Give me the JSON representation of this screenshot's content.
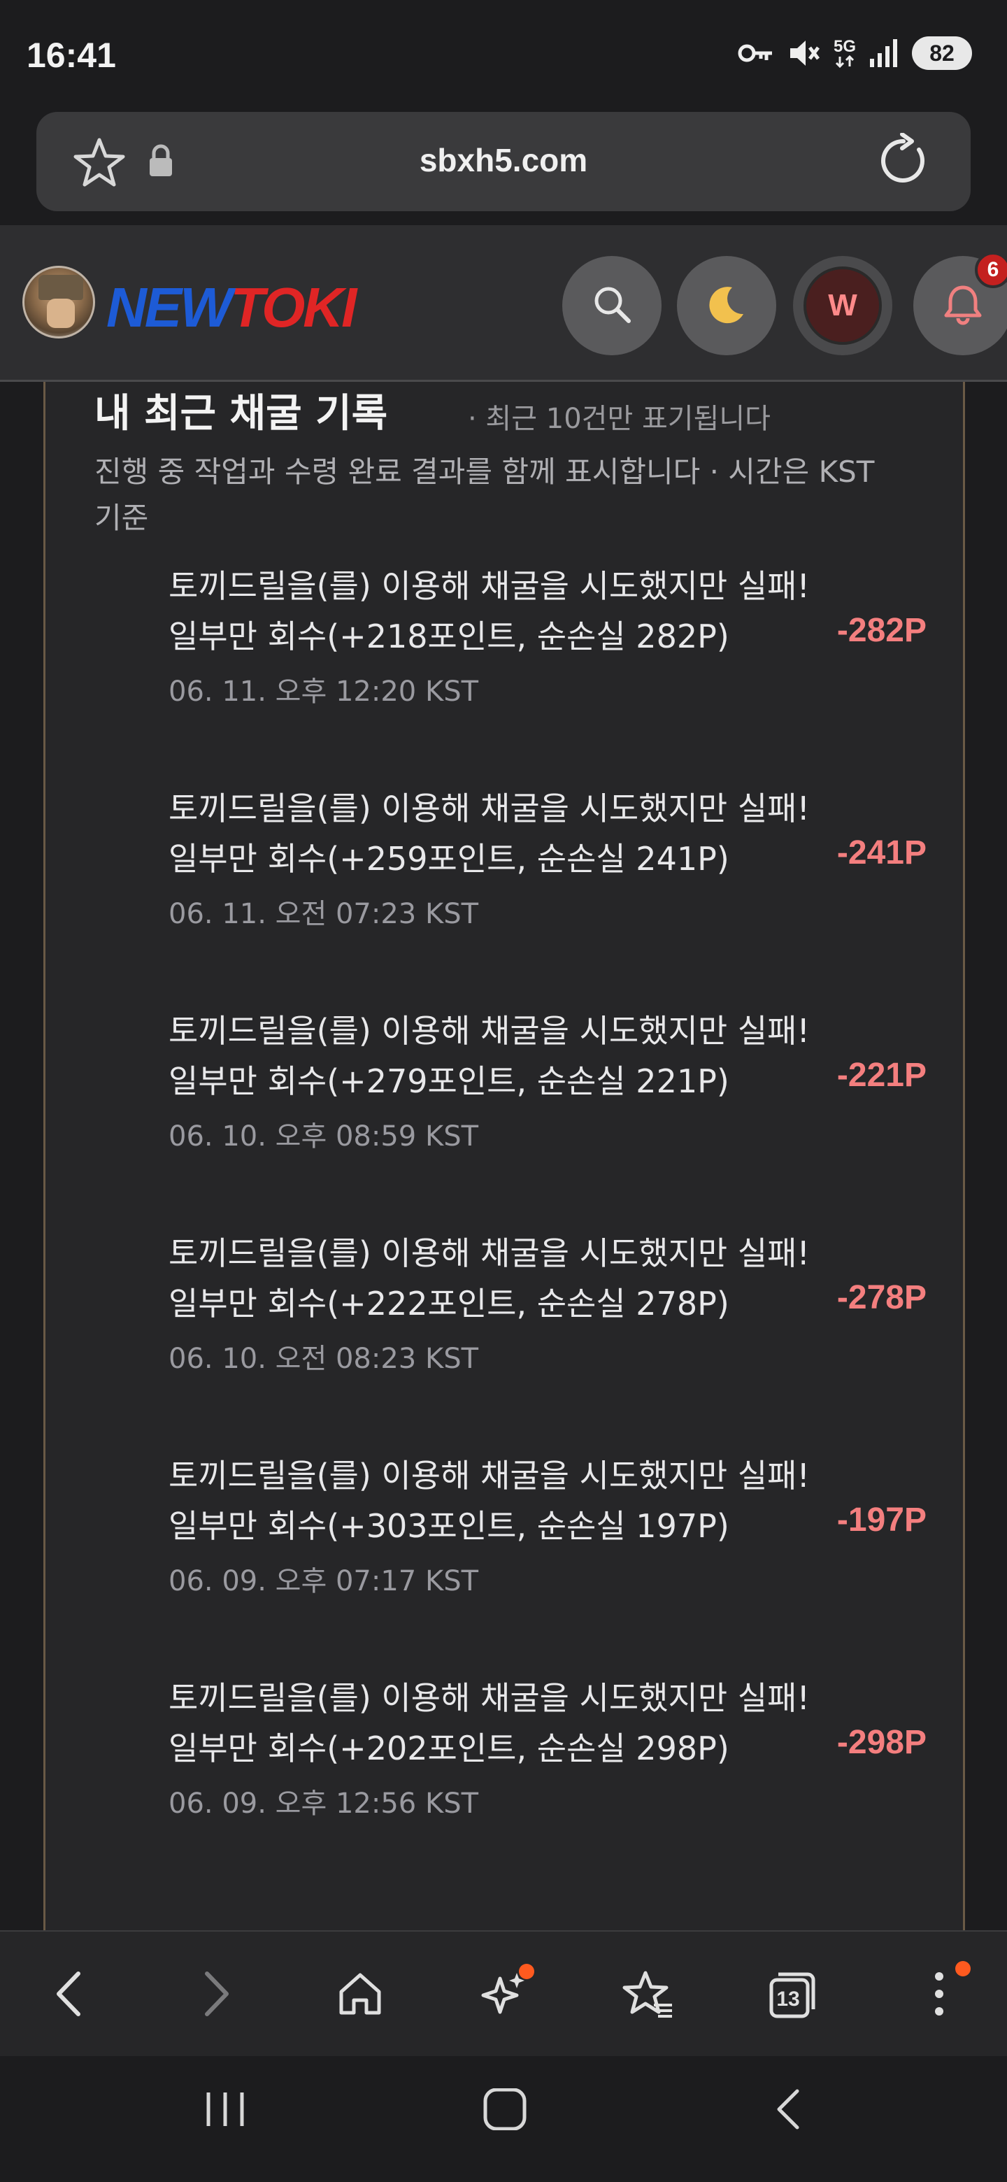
{
  "status_bar": {
    "time": "16:41",
    "network": "5G",
    "battery": "82",
    "icons": [
      "key-icon",
      "mute-icon",
      "5g-icon",
      "signal-icon",
      "battery-icon"
    ]
  },
  "url_bar": {
    "url": "sbxh5.com",
    "icons": [
      "star-icon",
      "lock-icon",
      "reload-icon"
    ]
  },
  "header": {
    "logo_part1": "NEW",
    "logo_part2": "TOKI",
    "user_initial": "W",
    "notification_count": "6",
    "logo_colors": {
      "new": "#1d5bd6",
      "toki": "#e02525"
    }
  },
  "section": {
    "title": "내 최근 채굴 기록",
    "note": "· 최근 10건만 표기됩니다",
    "description": "진행 중 작업과 수령 완료 결과를 함께 표시합니다 · 시간은 KST 기준"
  },
  "records": [
    {
      "text": "토끼드릴을(를) 이용해 채굴을 시도했지만 실패! 일부만 회수(+218포인트, 순손실 282P)",
      "date": "06. 11. 오후 12:20 KST",
      "amount": "-282P"
    },
    {
      "text": "토끼드릴을(를) 이용해 채굴을 시도했지만 실패! 일부만 회수(+259포인트, 순손실 241P)",
      "date": "06. 11. 오전 07:23 KST",
      "amount": "-241P"
    },
    {
      "text": "토끼드릴을(를) 이용해 채굴을 시도했지만 실패! 일부만 회수(+279포인트, 순손실 221P)",
      "date": "06. 10. 오후 08:59 KST",
      "amount": "-221P"
    },
    {
      "text": "토끼드릴을(를) 이용해 채굴을 시도했지만 실패! 일부만 회수(+222포인트, 순손실 278P)",
      "date": "06. 10. 오전 08:23 KST",
      "amount": "-278P"
    },
    {
      "text": "토끼드릴을(를) 이용해 채굴을 시도했지만 실패! 일부만 회수(+303포인트, 순손실 197P)",
      "date": "06. 09. 오후 07:17 KST",
      "amount": "-197P"
    },
    {
      "text": "토끼드릴을(를) 이용해 채굴을 시도했지만 실패! 일부만 회수(+202포인트, 순손실 298P)",
      "date": "06. 09. 오후 12:56 KST",
      "amount": "-298P"
    }
  ],
  "toolbar": {
    "tab_count": "13",
    "icons": [
      "back-icon",
      "forward-icon",
      "home-icon",
      "ai-sparkle-icon",
      "bookmarks-icon",
      "tabs-icon",
      "more-icon"
    ]
  },
  "colors": {
    "background": "#1c1c1e",
    "amount_negative": "#f47f7f",
    "badge": "#c4201f",
    "notification_dot": "#ff5a1f"
  }
}
